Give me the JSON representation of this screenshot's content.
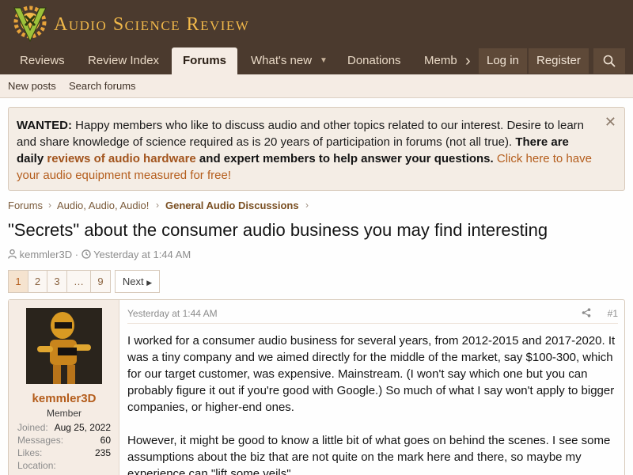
{
  "site": {
    "name": "Audio Science Review"
  },
  "nav": {
    "tabs": [
      "Reviews",
      "Review Index",
      "Forums",
      "What's new",
      "Donations",
      "Memb"
    ],
    "login": "Log in",
    "register": "Register"
  },
  "subnav": {
    "new_posts": "New posts",
    "search_forums": "Search forums"
  },
  "notice": {
    "t1": "WANTED:",
    "t2": " Happy members who like to discuss audio and other topics related to our interest. Desire to learn and share knowledge of science required as is 20 years of participation in forums (not all true). ",
    "t3": "There are daily ",
    "t4": "reviews of audio hardware",
    "t5": " and expert members to help answer your questions.",
    "t6": " Click here to have your audio equipment measured for free!"
  },
  "breadcrumb": [
    "Forums",
    "Audio, Audio, Audio!",
    "General Audio Discussions"
  ],
  "thread": {
    "title": "\"Secrets\" about the consumer audio business you may find interesting",
    "author": "kemmler3D",
    "date": "Yesterday at 1:44 AM"
  },
  "pager": {
    "pages": [
      "1",
      "2",
      "3",
      "…",
      "9"
    ],
    "next": "Next"
  },
  "post": {
    "username": "kemmler3D",
    "role": "Member",
    "stats": [
      {
        "label": "Joined:",
        "value": "Aug 25, 2022"
      },
      {
        "label": "Messages:",
        "value": "60"
      },
      {
        "label": "Likes:",
        "value": "235"
      },
      {
        "label": "Location:",
        "value": ""
      }
    ],
    "date": "Yesterday at 1:44 AM",
    "number": "#1",
    "p1": "I worked for a consumer audio business for several years, from 2012-2015 and 2017-2020. It was a tiny company and we aimed directly for the middle of the market, say $100-300, which for our target customer, was expensive. Mainstream. (I won't say which one but you can probably figure it out if you're good with Google.) So much of what I say won't apply to bigger companies, or higher-end ones.",
    "p2": "However, it might be good to know a little bit of what goes on behind the scenes. I see some assumptions about the biz that are not quite on the mark here and there, so maybe my experience can \"lift some veils\"."
  },
  "colors": {
    "header": "#4b3a2e",
    "accent": "#b45d1c",
    "logo_text": "#f2b94a"
  },
  "icons": [
    "logo-icon",
    "chevron-right-icon",
    "search-icon",
    "close-icon",
    "user-icon",
    "clock-icon",
    "caret-right-icon",
    "share-icon",
    "caret-down-icon"
  ]
}
